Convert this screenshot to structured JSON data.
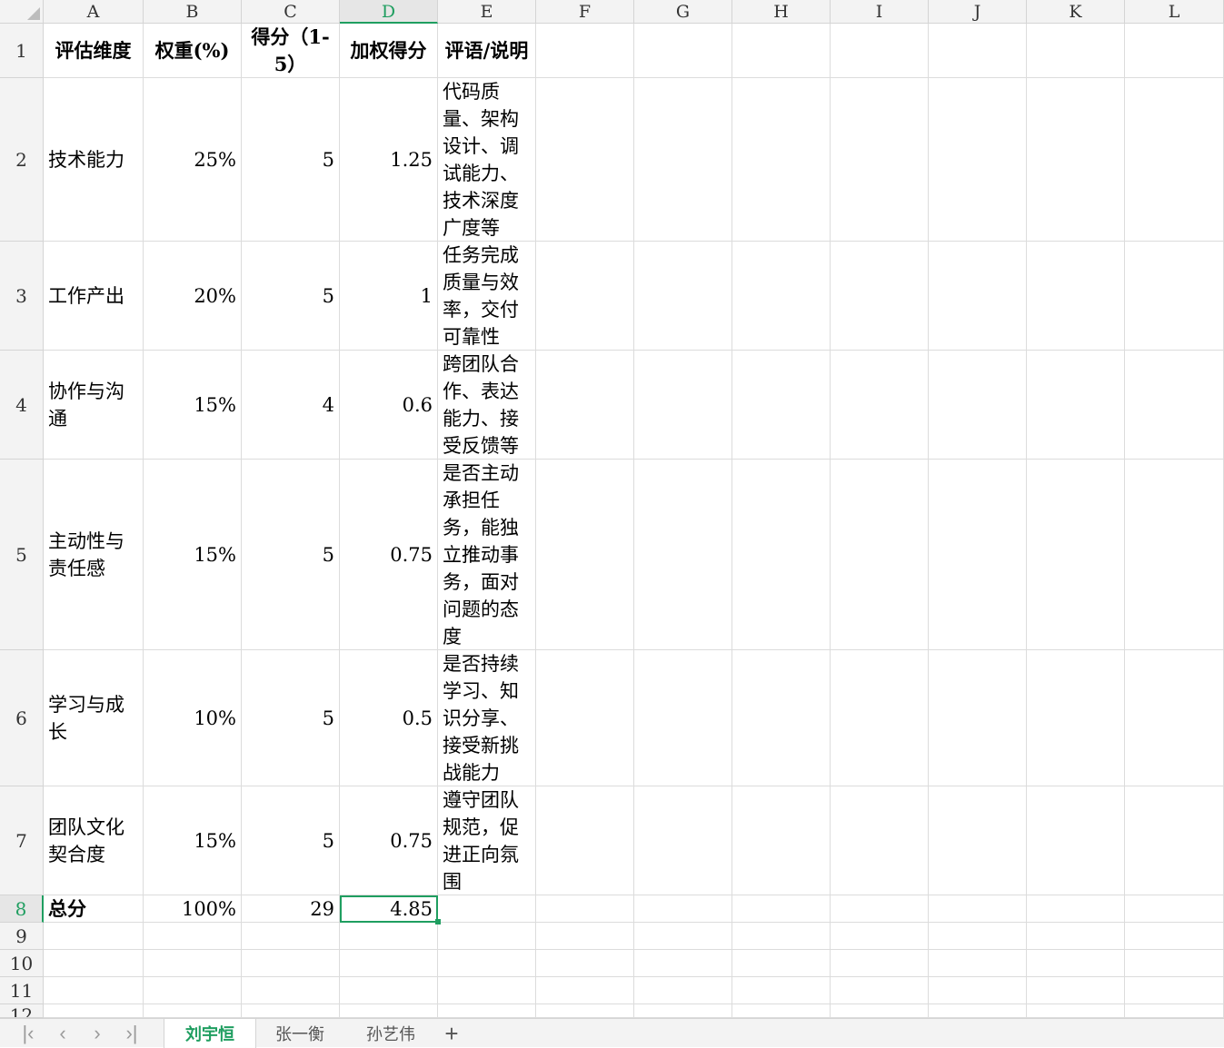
{
  "columns": [
    "A",
    "B",
    "C",
    "D",
    "E",
    "F",
    "G",
    "H",
    "I",
    "J",
    "K",
    "L"
  ],
  "rows": [
    "1",
    "2",
    "3",
    "4",
    "5",
    "6",
    "7",
    "8",
    "9",
    "10",
    "11",
    "12"
  ],
  "header": {
    "a": "评估维度",
    "b": "权重(%)",
    "c": "得分（1-5）",
    "d": "加权得分",
    "e": "评语/说明"
  },
  "data_rows": [
    {
      "dimension": "技术能力",
      "weight": "25%",
      "score": "5",
      "weighted": "1.25",
      "comment": "代码质量、架构设计、调试能力、技术深度广度等"
    },
    {
      "dimension": "工作产出",
      "weight": "20%",
      "score": "5",
      "weighted": "1",
      "comment": "任务完成质量与效率，交付可靠性"
    },
    {
      "dimension": "协作与沟通",
      "weight": "15%",
      "score": "4",
      "weighted": "0.6",
      "comment": "跨团队合作、表达能力、接受反馈等"
    },
    {
      "dimension": "主动性与责任感",
      "weight": "15%",
      "score": "5",
      "weighted": "0.75",
      "comment": "是否主动承担任务，能独立推动事务，面对问题的态度"
    },
    {
      "dimension": "学习与成长",
      "weight": "10%",
      "score": "5",
      "weighted": "0.5",
      "comment": "是否持续学习、知识分享、接受新挑战能力"
    },
    {
      "dimension": "团队文化契合度",
      "weight": "15%",
      "score": "5",
      "weighted": "0.75",
      "comment": "遵守团队规范，促进正向氛围"
    }
  ],
  "total": {
    "label": "总分",
    "weight": "100%",
    "score": "29",
    "weighted": "4.85"
  },
  "selection": {
    "column": "D",
    "row": "8"
  },
  "sheet_tabs": [
    "刘宇恒",
    "张一衡",
    "孙艺伟"
  ],
  "active_sheet": "刘宇恒",
  "colors": {
    "accent": "#1f9e60",
    "grid": "#dcdcdc",
    "header_bg": "#f3f3f3"
  },
  "icons": {
    "first": "first-sheet-icon",
    "prev": "prev-sheet-icon",
    "next": "next-sheet-icon",
    "last": "last-sheet-icon",
    "add": "add-sheet-icon"
  }
}
